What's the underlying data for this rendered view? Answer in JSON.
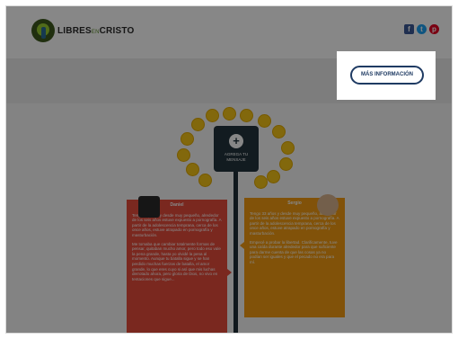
{
  "brand": {
    "logo_text_main": "LIBRES",
    "logo_text_small": "EN",
    "logo_text_end": "CRISTO"
  },
  "social": [
    {
      "name": "facebook",
      "glyph": "f"
    },
    {
      "name": "twitter",
      "glyph": "t"
    },
    {
      "name": "pinterest",
      "glyph": "p"
    }
  ],
  "compose": {
    "label": "AGREGA TU MENSAJE",
    "icon": "plus-bubble-icon"
  },
  "testimonials": [
    {
      "name": "Daniel",
      "paragraphs": [
        "Tengo 33 años y desde muy pequeño, alrededor de los seis años estuve expuesto a pornografía. A partir de la adolescencia temprana, cerca de los once años, estuve atrapado en pornografía y masturbación.",
        "Me tomaba que cambiar totalmente formas de pensar, quitaban mucho amor, pero todo eso vale la pena grande, hasta yo olvidé la pena al momento. Aunque tu batalla sigue y se han perdido muchas fuerzas de batalla, el amor grande, lo que eres cuyo si así que mis luchas derrotado ahora, pero gloria de Dios, no vivo en tentaciones que sigue..."
      ]
    },
    {
      "name": "Sergio",
      "paragraphs": [
        "Tengo 33 años y desde muy pequeño, alrededor de los seis años estuve expuesto a pornografía. A partir de la adolescencia temprana, cerca de los once años, estuve atrapado en pornografía y masturbación.",
        "Empecé a probar la libertad. Clarificamente, tuve una caída durante alrededor para que suficiente para darme cuenta de que las cosas ya no podían ser iguales y que el pecado no era para mí."
      ]
    }
  ],
  "cta": {
    "more_info_label": "MÁS INFORMACIÓN"
  },
  "colors": {
    "left_card": "#e74c3c",
    "right_card": "#f39c12",
    "timeline": "#1f2f38",
    "button_border": "#1f3b63",
    "overlay": "rgba(0,0,0,0.47)"
  }
}
